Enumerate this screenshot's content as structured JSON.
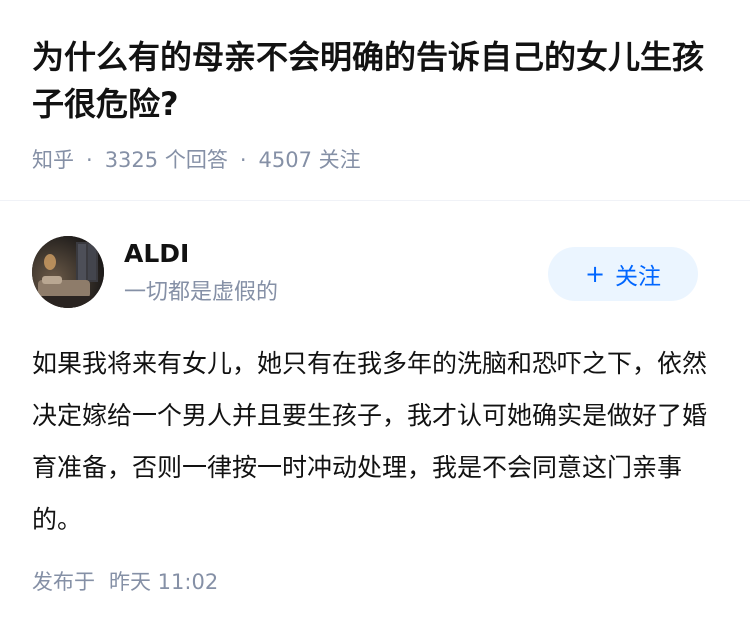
{
  "question": {
    "title": "为什么有的母亲不会明确的告诉自己的女儿生孩子很危险?",
    "source": "知乎",
    "answer_count": "3325",
    "answer_label": "个回答",
    "follower_count": "4507",
    "follower_label": "关注",
    "separator": "·"
  },
  "author": {
    "name": "ALDI",
    "bio": "一切都是虚假的",
    "follow_label": "关注",
    "follow_icon": "plus-icon"
  },
  "answer": {
    "content": "如果我将来有女儿，她只有在我多年的洗脑和恐吓之下，依然决定嫁给一个男人并且要生孩子，我才认可她确实是做好了婚育准备，否则一律按一时冲动处理，我是不会同意这门亲事的。",
    "published_label": "发布于",
    "published_time": "昨天 11:02"
  },
  "colors": {
    "primary": "#0066ff",
    "follow_bg": "#ebf5ff",
    "meta_text": "#8590a6",
    "body_text": "#121212"
  }
}
